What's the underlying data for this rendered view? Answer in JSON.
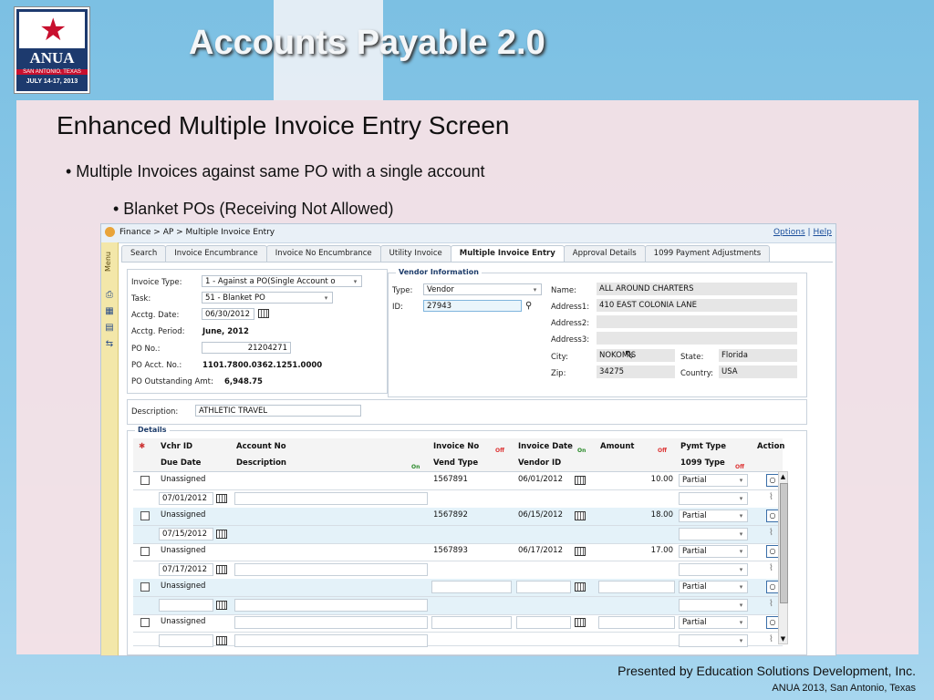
{
  "slide": {
    "title": "Accounts Payable 2.0",
    "subtitle": "Enhanced Multiple Invoice Entry Screen",
    "bullet1": "• Multiple Invoices against  same PO with a single account",
    "bullet2": "• Blanket POs (Receiving Not Allowed)",
    "footer_line1": "Presented by Education Solutions Development, Inc.",
    "footer_line2": "ANUA 2013, San Antonio, Texas"
  },
  "logo": {
    "name": "ANUA",
    "city": "SAN ANTONIO, TEXAS",
    "dates": "JULY 14-17, 2013"
  },
  "app": {
    "breadcrumb": "Finance > AP > Multiple Invoice Entry",
    "options": "Options",
    "separator": "|",
    "help": "Help",
    "side_menu": "Menu",
    "tabs": [
      "Search",
      "Invoice Encumbrance",
      "Invoice No Encumbrance",
      "Utility Invoice",
      "Multiple Invoice Entry",
      "Approval Details",
      "1099 Payment Adjustments"
    ],
    "invoice": {
      "type_label": "Invoice Type:",
      "type_value": "1 - Against a PO(Single Account o",
      "task_label": "Task:",
      "task_value": "51 - Blanket PO",
      "acctg_date_label": "Acctg. Date:",
      "acctg_date_value": "06/30/2012",
      "acctg_period_label": "Acctg. Period:",
      "acctg_period_value": "June, 2012",
      "po_no_label": "PO No.:",
      "po_no_value": "21204271",
      "po_acct_label": "PO Acct. No.:",
      "po_acct_value": "1101.7800.0362.1251.0000",
      "po_out_label": "PO Outstanding Amt:",
      "po_out_value": "6,948.75"
    },
    "vendor": {
      "legend": "Vendor Information",
      "type_label": "Type:",
      "type_value": "Vendor",
      "id_label": "ID:",
      "id_value": "27943",
      "name_label": "Name:",
      "name_value": "ALL AROUND CHARTERS",
      "addr1_label": "Address1:",
      "addr1_value": "410 EAST COLONIA LANE",
      "addr2_label": "Address2:",
      "addr3_label": "Address3:",
      "city_label": "City:",
      "city_value": "NOKOMIS",
      "state_label": "State:",
      "state_value": "Florida",
      "zip_label": "Zip:",
      "zip_value": "34275",
      "country_label": "Country:",
      "country_value": "USA"
    },
    "description": {
      "label": "Description:",
      "value": "ATHLETIC TRAVEL"
    },
    "details": {
      "legend": "Details",
      "headers": {
        "vchr_id": "Vchr ID",
        "account_no": "Account No",
        "invoice_no": "Invoice No",
        "invoice_date": "Invoice Date",
        "amount": "Amount",
        "pymt_type": "Pymt Type",
        "action": "Action",
        "due_date": "Due Date",
        "description": "Description",
        "vend_type": "Vend Type",
        "vendor_id": "Vendor ID",
        "type_1099": "1099 Type"
      },
      "tags": {
        "off": "Off",
        "on": "On"
      },
      "rows": [
        {
          "vchr": "Unassigned",
          "invoice_no": "1567891",
          "invoice_date": "06/01/2012",
          "amount": "10.00",
          "pymt": "Partial",
          "due_date": "07/01/2012"
        },
        {
          "vchr": "Unassigned",
          "invoice_no": "1567892",
          "invoice_date": "06/15/2012",
          "amount": "18.00",
          "pymt": "Partial",
          "due_date": "07/15/2012"
        },
        {
          "vchr": "Unassigned",
          "invoice_no": "1567893",
          "invoice_date": "06/17/2012",
          "amount": "17.00",
          "pymt": "Partial",
          "due_date": "07/17/2012"
        },
        {
          "vchr": "Unassigned",
          "invoice_no": "",
          "invoice_date": "",
          "amount": "",
          "pymt": "Partial",
          "due_date": ""
        },
        {
          "vchr": "Unassigned",
          "invoice_no": "",
          "invoice_date": "",
          "amount": "",
          "pymt": "Partial",
          "due_date": ""
        }
      ]
    }
  }
}
